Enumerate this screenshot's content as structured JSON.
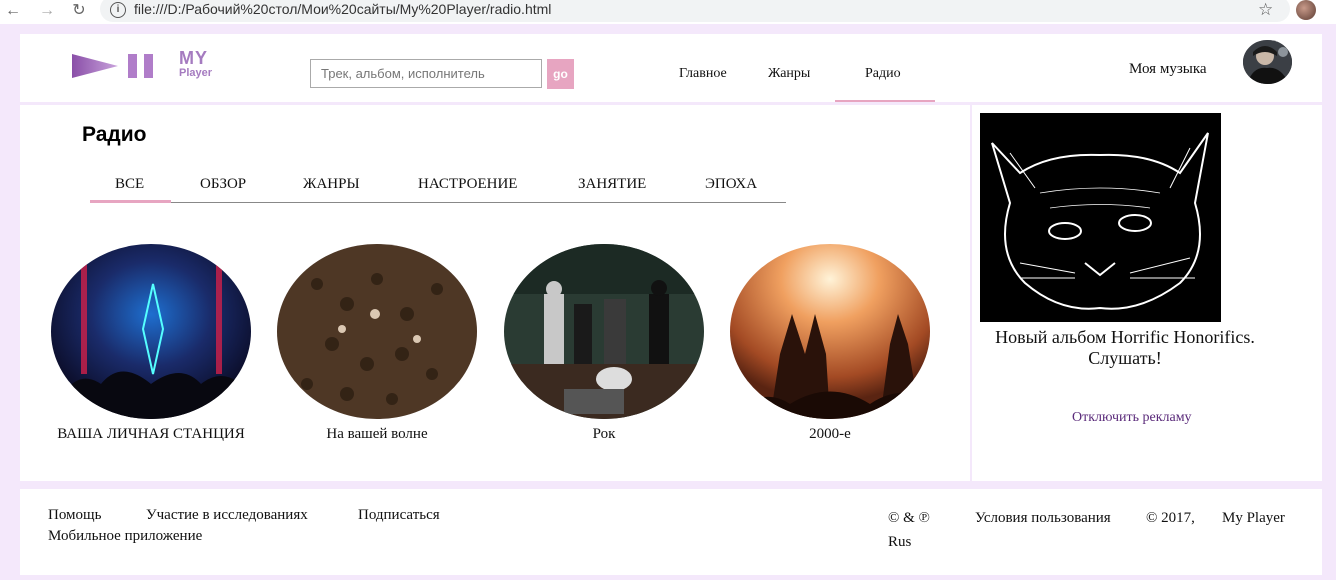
{
  "browser": {
    "url": "file:///D:/Рабочий%20стол/Мои%20сайты/My%20Player/radio.html"
  },
  "header": {
    "logo_my": "MY",
    "logo_player": "Player",
    "search_placeholder": "Трек, альбом, исполнитель",
    "search_button": "go",
    "nav": [
      "Главное",
      "Жанры",
      "Радио"
    ],
    "my_music": "Моя музыка"
  },
  "main": {
    "title": "Радио",
    "tabs": [
      "ВСЕ",
      "ОБЗОР",
      "ЖАНРЫ",
      "НАСТРОЕНИЕ",
      "ЗАНЯТИЕ",
      "ЭПОХА"
    ],
    "stations": [
      {
        "label": "ВАША ЛИЧНАЯ СТАНЦИЯ"
      },
      {
        "label": "На вашей волне"
      },
      {
        "label": "Рок"
      },
      {
        "label": "2000-е"
      }
    ]
  },
  "sidebar": {
    "ad_text": "Новый альбом Horrific Honorifics. Слушать!",
    "disable_ads": "Отключить рекламу"
  },
  "footer": {
    "help": "Помощь",
    "research": "Участие в исследованиях",
    "subscribe": "Подписаться",
    "mobile_app": "Мобильное приложение",
    "copyright_symbols": "© & ℗",
    "language": "Rus",
    "terms": "Условия пользования",
    "year": "© 2017,",
    "brand": "My Player"
  },
  "colors": {
    "accent": "#e7a5c1",
    "brand": "#a57bc0",
    "page_bg": "#f4e8fb"
  }
}
